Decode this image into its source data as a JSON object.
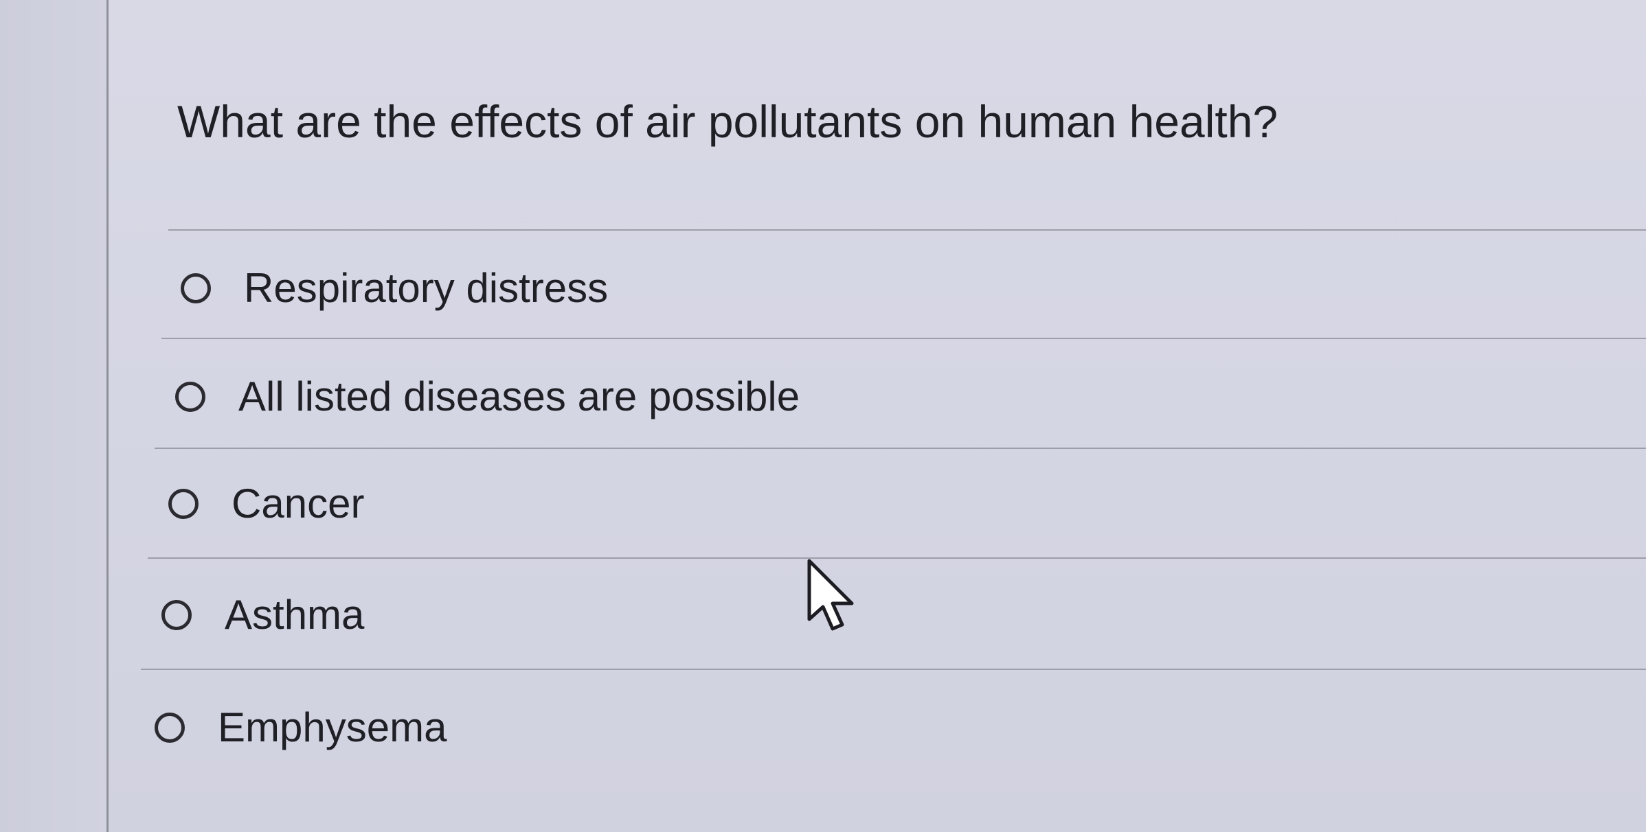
{
  "quiz": {
    "question": "What are the effects of air pollutants on human health?",
    "options": [
      {
        "label": "Respiratory distress",
        "selected": false
      },
      {
        "label": "All listed diseases are possible",
        "selected": false
      },
      {
        "label": "Cancer",
        "selected": false
      },
      {
        "label": "Asthma",
        "selected": false
      },
      {
        "label": "Emphysema",
        "selected": false
      }
    ]
  },
  "colors": {
    "background": "#d6d6e3",
    "text": "#1f1f26",
    "divider": "#9d9ea9"
  },
  "icons": {
    "radio": "radio-button-unselected-icon",
    "pointer": "mouse-pointer-icon"
  }
}
